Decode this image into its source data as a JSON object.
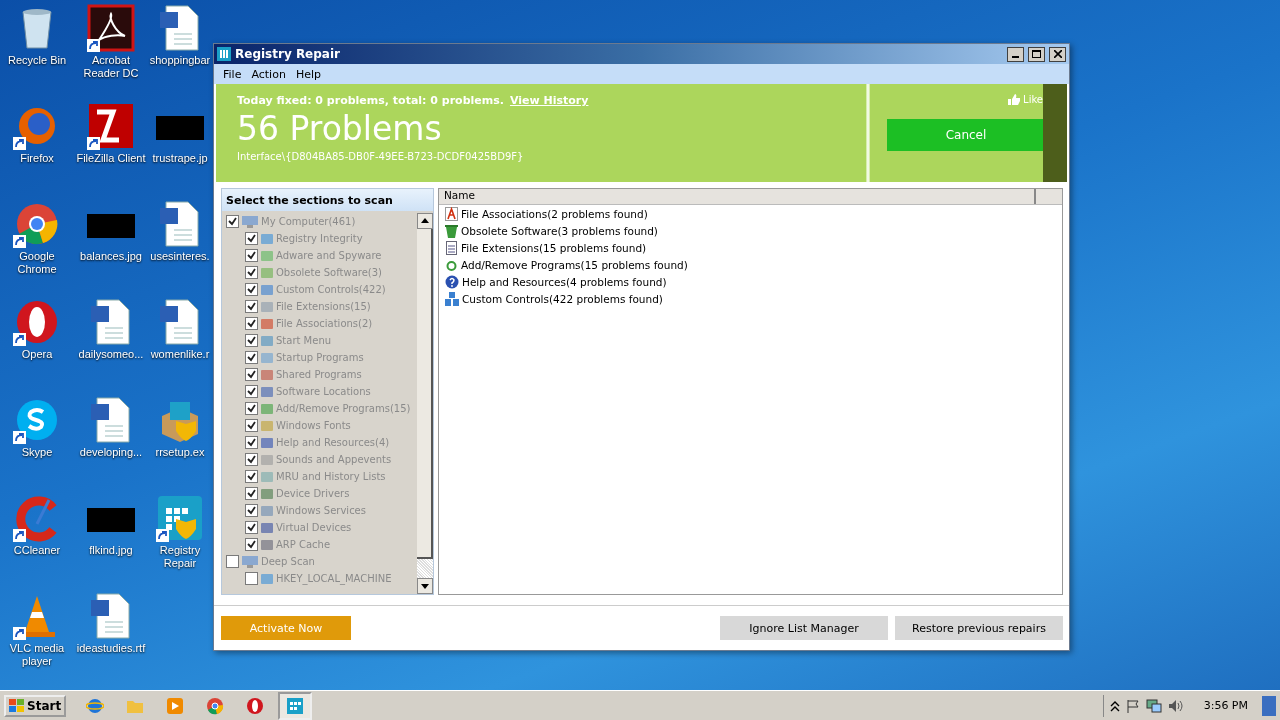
{
  "desktop_icons": [
    {
      "label": "Recycle Bin",
      "kind": "recycle",
      "shortcut": false
    },
    {
      "label": "Firefox",
      "kind": "firefox",
      "shortcut": true
    },
    {
      "label": "Google Chrome",
      "kind": "chrome",
      "shortcut": true
    },
    {
      "label": "Opera",
      "kind": "opera",
      "shortcut": true
    },
    {
      "label": "Skype",
      "kind": "skype",
      "shortcut": true
    },
    {
      "label": "CCleaner",
      "kind": "ccleaner",
      "shortcut": true
    },
    {
      "label": "VLC media player",
      "kind": "vlc",
      "shortcut": true
    },
    {
      "label": "Acrobat Reader DC",
      "kind": "pdf",
      "shortcut": true
    },
    {
      "label": "FileZilla Client",
      "kind": "filezilla",
      "shortcut": true
    },
    {
      "label": "balances.jpg",
      "kind": "image",
      "shortcut": false
    },
    {
      "label": "dailysomeo...",
      "kind": "word",
      "shortcut": false
    },
    {
      "label": "developing...",
      "kind": "word",
      "shortcut": false
    },
    {
      "label": "flkind.jpg",
      "kind": "image",
      "shortcut": false
    },
    {
      "label": "ideastudies.rtf",
      "kind": "word",
      "shortcut": false
    },
    {
      "label": "shoppingbar",
      "kind": "word",
      "shortcut": false
    },
    {
      "label": "trustrape.jp",
      "kind": "image",
      "shortcut": false
    },
    {
      "label": "usesinteres.",
      "kind": "word",
      "shortcut": false
    },
    {
      "label": "womenlike.r",
      "kind": "word",
      "shortcut": false
    },
    {
      "label": "rrsetup.ex",
      "kind": "installer",
      "shortcut": false
    },
    {
      "label": "Registry Repair",
      "kind": "app",
      "shortcut": true
    }
  ],
  "window": {
    "title": "Registry Repair",
    "menu": [
      "File",
      "Action",
      "Help"
    ],
    "header": {
      "status": "Today fixed: 0 problems, total: 0 problems.",
      "history_link": "View History",
      "headline": "56 Problems",
      "current_item": "Interface\\{D804BA85-DB0F-49EE-B723-DCDF0425BD9F}",
      "like": "Like",
      "cancel": "Cancel"
    },
    "sections": {
      "title": "Select the sections to scan",
      "disabled": true,
      "tree": [
        {
          "label": "My Computer(461)",
          "checked": true,
          "children": [
            {
              "label": "Registry Integrity",
              "checked": true
            },
            {
              "label": "Adware and Spyware",
              "checked": true
            },
            {
              "label": "Obsolete Software(3)",
              "checked": true
            },
            {
              "label": "Custom Controls(422)",
              "checked": true
            },
            {
              "label": "File Extensions(15)",
              "checked": true
            },
            {
              "label": "File Associations(2)",
              "checked": true
            },
            {
              "label": "Start Menu",
              "checked": true
            },
            {
              "label": "Startup Programs",
              "checked": true
            },
            {
              "label": "Shared Programs",
              "checked": true
            },
            {
              "label": "Software Locations",
              "checked": true
            },
            {
              "label": "Add/Remove Programs(15)",
              "checked": true
            },
            {
              "label": "Windows Fonts",
              "checked": true
            },
            {
              "label": "Help and Resources(4)",
              "checked": true
            },
            {
              "label": "Sounds and Appevents",
              "checked": true
            },
            {
              "label": "MRU and History Lists",
              "checked": true
            },
            {
              "label": "Device Drivers",
              "checked": true
            },
            {
              "label": "Windows Services",
              "checked": true
            },
            {
              "label": "Virtual Devices",
              "checked": true
            },
            {
              "label": "ARP Cache",
              "checked": true
            }
          ]
        },
        {
          "label": "Deep Scan",
          "checked": false,
          "children": [
            {
              "label": "HKEY_LOCAL_MACHINE",
              "checked": false
            }
          ]
        }
      ]
    },
    "results": {
      "column": "Name",
      "rows": [
        {
          "label": "File Associations(2 problems found)",
          "kind": "letter"
        },
        {
          "label": "Obsolete Software(3 problems found)",
          "kind": "bin"
        },
        {
          "label": "File Extensions(15 problems found)",
          "kind": "document"
        },
        {
          "label": "Add/Remove Programs(15 problems found)",
          "kind": "recycle"
        },
        {
          "label": "Help and Resources(4 problems found)",
          "kind": "help"
        },
        {
          "label": "Custom Controls(422 problems found)",
          "kind": "blocks"
        }
      ]
    },
    "footer": {
      "activate": "Activate Now",
      "buttons": [
        "Ignore List Manager",
        "Restore previous repairs"
      ]
    }
  },
  "taskbar": {
    "start": "Start",
    "apps": [
      {
        "kind": "ie",
        "selected": false
      },
      {
        "kind": "folder",
        "selected": false
      },
      {
        "kind": "media",
        "selected": false
      },
      {
        "kind": "chrome",
        "selected": false
      },
      {
        "kind": "opera",
        "selected": false
      },
      {
        "kind": "app",
        "selected": true
      }
    ],
    "clock": "3:56 PM"
  }
}
